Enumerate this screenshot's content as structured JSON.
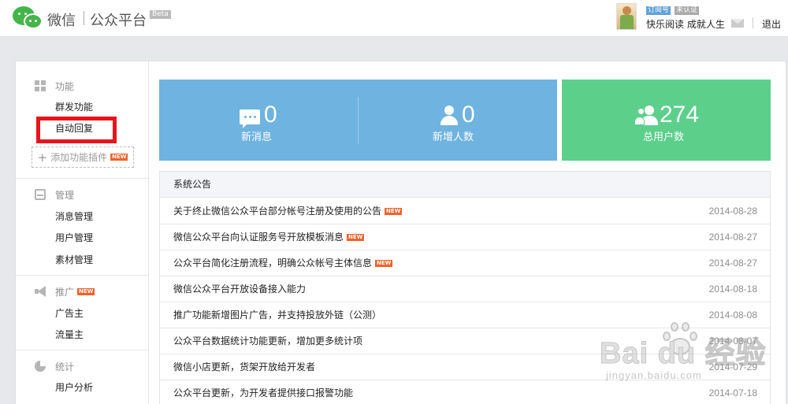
{
  "header": {
    "brand": "微信",
    "platform": "公众平台",
    "beta": "Beta",
    "account_tag": "订阅号",
    "verify_tag": "未认证",
    "account_name": "快乐阅读 成就人生",
    "logout": "退出"
  },
  "sidebar": {
    "sections": [
      {
        "title": "功能",
        "icon": "grid-icon",
        "items": [
          "群发功能",
          "自动回复"
        ]
      },
      {
        "title": "管理",
        "icon": "inbox-icon",
        "items": [
          "消息管理",
          "用户管理",
          "素材管理"
        ]
      },
      {
        "title": "推广",
        "icon": "megaphone-icon",
        "new": "NEW",
        "items": [
          "广告主",
          "流量主"
        ]
      },
      {
        "title": "统计",
        "icon": "pie-chart-icon",
        "items": [
          "用户分析"
        ]
      }
    ],
    "add_plugin": "添加功能插件",
    "add_plugin_new": "NEW",
    "highlighted_item": "自动回复",
    "highlight_color": "#e8141b"
  },
  "stats": {
    "new_messages": {
      "value": "0",
      "label": "新消息",
      "icon": "chat-icon"
    },
    "new_users": {
      "value": "0",
      "label": "新增人数",
      "icon": "user-icon"
    },
    "total_users": {
      "value": "274",
      "label": "总用户数",
      "icon": "users-icon"
    },
    "colors": {
      "blue": "#6fb3e0",
      "green": "#5ccf8b"
    }
  },
  "notices": {
    "title": "系统公告",
    "new_badge": "NEW",
    "items": [
      {
        "title": "关于终止微信公众平台部分帐号注册及使用的公告",
        "date": "2014-08-28",
        "new": true
      },
      {
        "title": "微信公众平台向认证服务号开放模板消息",
        "date": "2014-08-27",
        "new": true
      },
      {
        "title": "公众平台简化注册流程，明确公众帐号主体信息",
        "date": "2014-08-27",
        "new": true
      },
      {
        "title": "微信公众平台开放设备接入能力",
        "date": "2014-08-18",
        "new": false
      },
      {
        "title": "推广功能新增图片广告，并支持投放外链（公测）",
        "date": "2014-08-08",
        "new": false
      },
      {
        "title": "公众平台数据统计功能更新，增加更多统计项",
        "date": "2014-08-07",
        "new": false
      },
      {
        "title": "微信小店更新，货架开放给开发者",
        "date": "2014-07-29",
        "new": false
      },
      {
        "title": "公众平台更新，为开发者提供接口报警功能",
        "date": "2014-07-18",
        "new": false
      }
    ]
  },
  "watermark": {
    "main": "Bai du 经验",
    "sub": "jingyan.baidu.com"
  }
}
